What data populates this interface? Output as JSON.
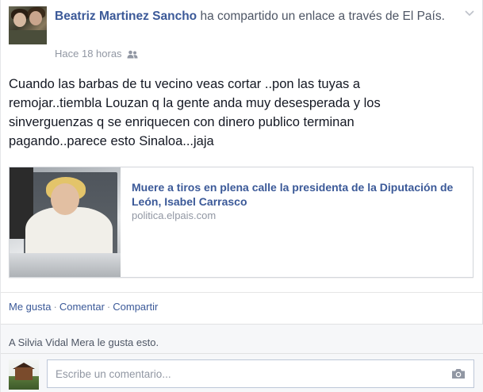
{
  "post": {
    "author": "Beatriz Martinez Sancho",
    "action": " ha compartido un enlace a través de El País.",
    "time": "Hace 18 horas",
    "privacy_icon": "friends-icon",
    "body": "Cuando las barbas de tu vecino veas cortar ..pon las tuyas a remojar..tiembla Louzan q la gente anda muy desesperada y los sinverguenzas q se enriquecen con dinero publico terminan pagando..parece esto Sinaloa...jaja"
  },
  "link": {
    "title": "Muere a tiros en plena calle la presidenta de la Diputación de León, Isabel Carrasco",
    "domain": "politica.elpais.com"
  },
  "actions": {
    "like": "Me gusta",
    "comment": "Comentar",
    "share": "Compartir",
    "separator": "·"
  },
  "likes": {
    "text": "A Silvia Vidal Mera le gusta esto."
  },
  "comment_box": {
    "placeholder": "Escribe un comentario...",
    "attach_icon": "camera-icon"
  },
  "colors": {
    "link_blue": "#3b5998",
    "meta_gray": "#9197a3",
    "text": "#141823"
  }
}
